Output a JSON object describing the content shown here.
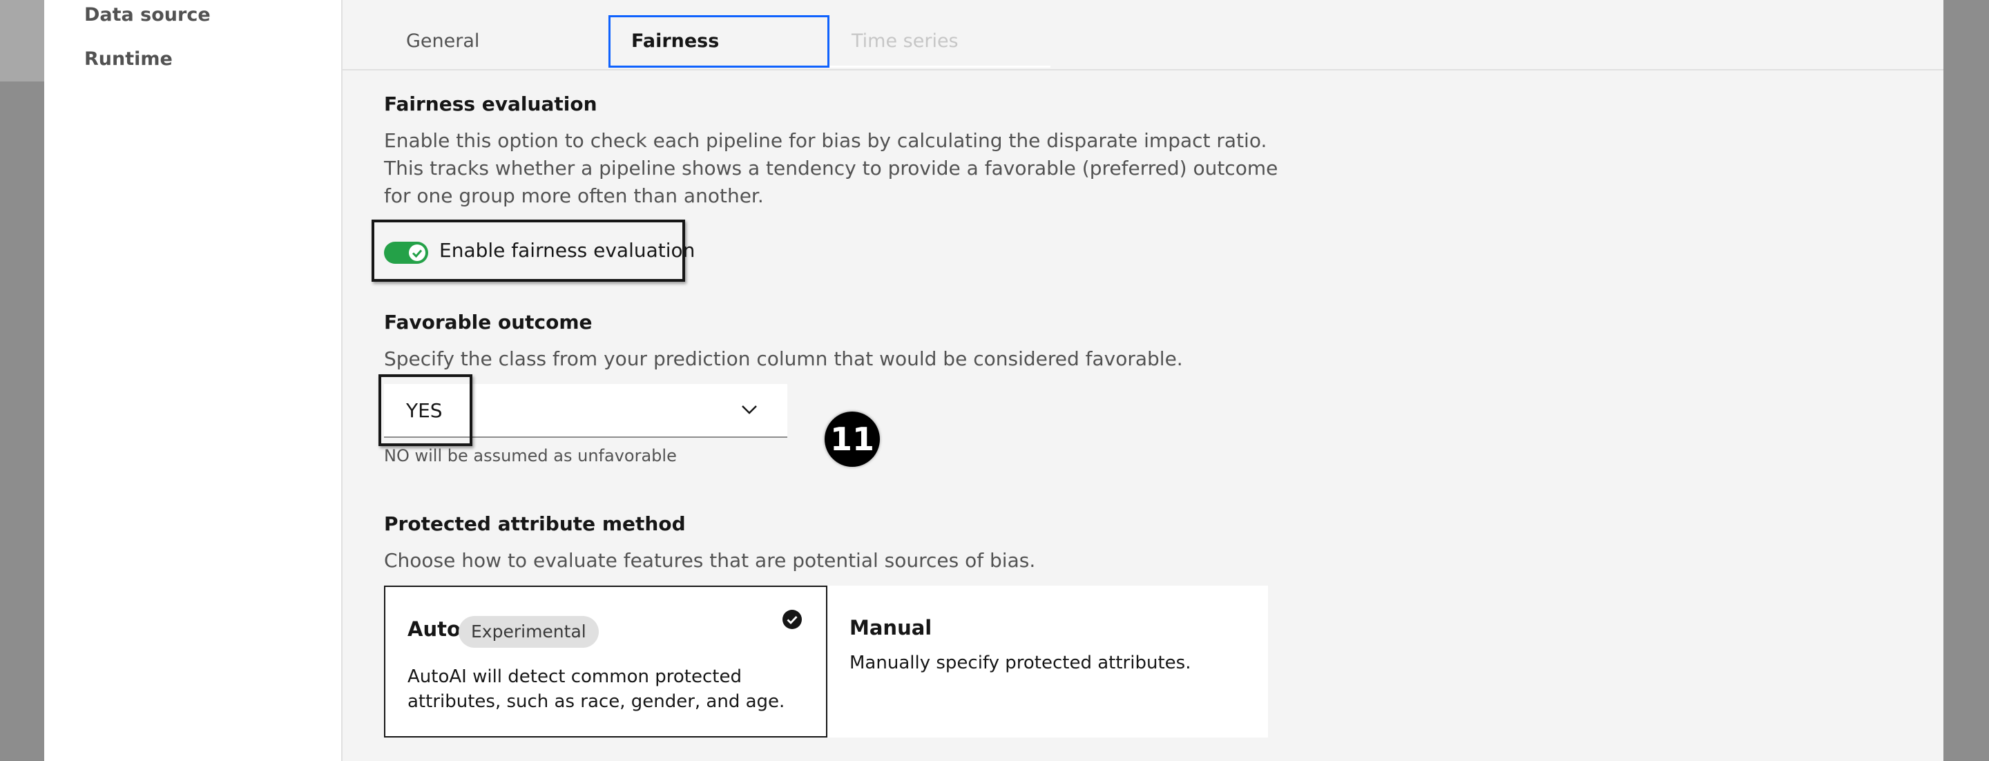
{
  "sidebar": {
    "items": [
      {
        "label": "Data source"
      },
      {
        "label": "Runtime"
      }
    ]
  },
  "tabs": [
    {
      "label": "General",
      "state": "default"
    },
    {
      "label": "Fairness",
      "state": "selected"
    },
    {
      "label": "Time series",
      "state": "disabled"
    }
  ],
  "fairness": {
    "heading": "Fairness evaluation",
    "description_lines": [
      "Enable this option to check each pipeline for bias by calculating the disparate impact ratio.",
      "This tracks whether a pipeline shows a tendency to provide a favorable (preferred) outcome",
      "for one group more often than another."
    ],
    "toggle_label": "Enable fairness evaluation",
    "toggle_on": true
  },
  "favorable": {
    "heading": "Favorable outcome",
    "description": "Specify the class from your prediction column that would be considered favorable.",
    "selected_value": "YES",
    "helper": "NO will be assumed as unfavorable"
  },
  "step_badge": "11",
  "protected": {
    "heading": "Protected attribute method",
    "description": "Choose how to evaluate features that are potential sources of bias.",
    "options": [
      {
        "title": "Auto",
        "tag": "Experimental",
        "description_lines": [
          "AutoAI will detect common protected",
          "attributes, such as race, gender, and age."
        ],
        "selected": true
      },
      {
        "title": "Manual",
        "description_lines": [
          "Manually specify protected attributes."
        ],
        "selected": false
      }
    ]
  },
  "colors": {
    "accent": "#0f62fe",
    "toggle_on": "#24a148",
    "background": "#f4f4f4"
  }
}
